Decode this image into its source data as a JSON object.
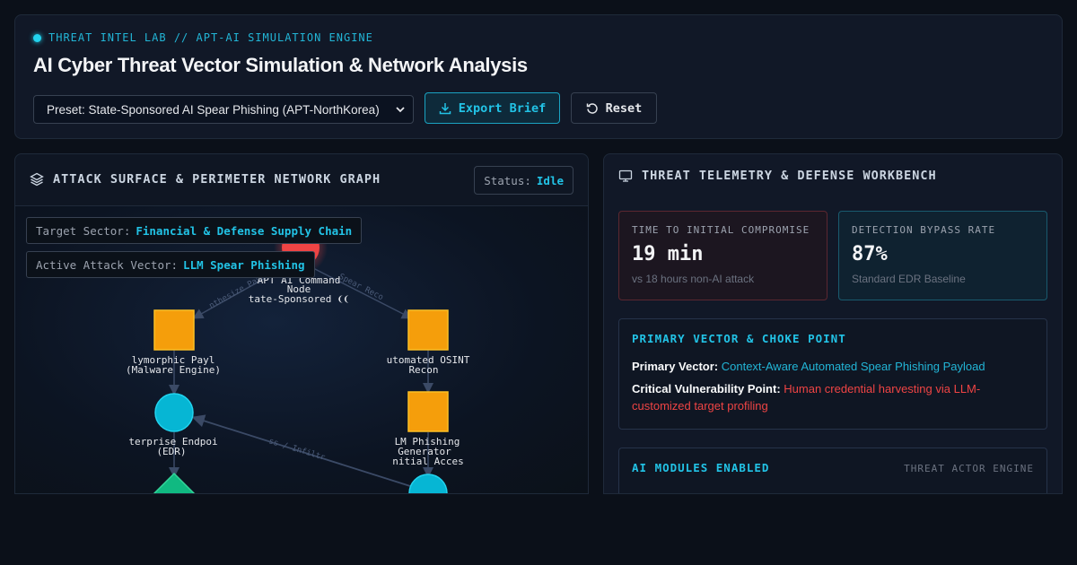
{
  "header": {
    "eyebrow": "THREAT INTEL LAB // APT-AI SIMULATION ENGINE",
    "title": "AI Cyber Threat Vector Simulation & Network Analysis",
    "preset_value": "Preset: State-Sponsored AI Spear Phishing (APT-NorthKorea)",
    "export_label": "Export Brief",
    "reset_label": "Reset"
  },
  "left_panel": {
    "title": "ATTACK SURFACE & PERIMETER NETWORK GRAPH",
    "status_label": "Status:",
    "status_value": "Idle",
    "target_label": "Target Sector:",
    "target_value": "Financial & Defense Supply Chain",
    "vector_label": "Active Attack Vector:",
    "vector_value": "LLM Spear Phishing",
    "graph": {
      "nodes": [
        {
          "id": "c2",
          "shape": "circle",
          "color": "#ef4444",
          "lines": [
            "APT AI Command",
            "Node",
            "tate-Sponsored ❨❨"
          ]
        },
        {
          "id": "payload",
          "shape": "square",
          "color": "#f59e0b",
          "lines": [
            "lymorphic Payl",
            "(Malware Engine)"
          ]
        },
        {
          "id": "osint",
          "shape": "square",
          "color": "#f59e0b",
          "lines": [
            "utomated OSINT",
            "Recon"
          ]
        },
        {
          "id": "endpoint",
          "shape": "circle",
          "color": "#06b6d4",
          "lines": [
            "terprise Endpoi",
            "(EDR)"
          ]
        },
        {
          "id": "phishing",
          "shape": "square",
          "color": "#f59e0b",
          "lines": [
            "LM Phishing",
            "Generator",
            "nitial Acces"
          ]
        },
        {
          "id": "diamond",
          "shape": "diamond",
          "color": "#10b981",
          "lines": []
        },
        {
          "id": "mailbox",
          "shape": "circle",
          "color": "#06b6d4",
          "lines": []
        }
      ],
      "edges": [
        {
          "from": "c2",
          "to": "payload",
          "label": "nthesize Pay"
        },
        {
          "from": "c2",
          "to": "osint",
          "label": "Spear Reco"
        },
        {
          "from": "mailbox",
          "to": "endpoint",
          "label": "ss / Infiltr"
        }
      ]
    }
  },
  "right_panel": {
    "title": "THREAT TELEMETRY & DEFENSE WORKBENCH",
    "metric1": {
      "label": "TIME TO INITIAL COMPROMISE",
      "value": "19 min",
      "sub": "vs 18 hours non-AI attack"
    },
    "metric2": {
      "label": "DETECTION BYPASS RATE",
      "value": "87%",
      "sub": "Standard EDR Baseline"
    },
    "primary": {
      "heading": "PRIMARY VECTOR & CHOKE POINT",
      "vector_label": "Primary Vector:",
      "vector_value": "Context-Aware Automated Spear Phishing Payload",
      "vuln_label": "Critical Vulnerability Point:",
      "vuln_value": "Human credential harvesting via LLM-customized target profiling"
    },
    "modules": {
      "heading": "AI MODULES ENABLED",
      "tag": "THREAT ACTOR ENGINE"
    }
  },
  "colors": {
    "accent": "#22c3e6",
    "danger": "#ef4444",
    "warning": "#f59e0b",
    "success": "#10b981",
    "bg": "#0b1019"
  }
}
